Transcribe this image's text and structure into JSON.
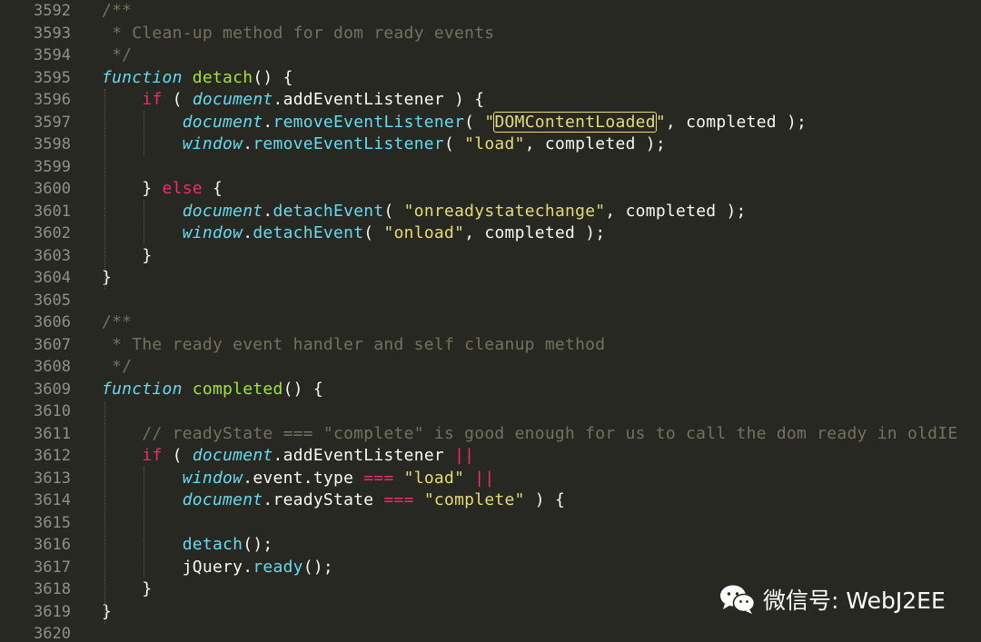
{
  "watermark": {
    "icon": "wechat-icon",
    "label": "微信号: WebJ2EE"
  },
  "colors": {
    "background": "#272822",
    "comment": "#75715e",
    "keyword": "#f92672",
    "function_name": "#a6e22e",
    "storage": "#66d9ef",
    "string": "#e6db74",
    "text": "#f8f8f2",
    "line_number": "#90908a"
  },
  "lines": [
    {
      "num": "3592",
      "tokens": [
        {
          "t": "comment",
          "v": "/**"
        }
      ]
    },
    {
      "num": "3593",
      "tokens": [
        {
          "t": "comment",
          "v": " * Clean-up method for dom ready events"
        }
      ]
    },
    {
      "num": "3594",
      "tokens": [
        {
          "t": "comment",
          "v": " */"
        }
      ]
    },
    {
      "num": "3595",
      "tokens": [
        {
          "t": "storage",
          "v": "function"
        },
        {
          "t": "plain",
          "v": " "
        },
        {
          "t": "fname",
          "v": "detach"
        },
        {
          "t": "plain",
          "v": "() {"
        }
      ]
    },
    {
      "num": "3596",
      "tokens": [
        {
          "t": "plain",
          "v": "    "
        },
        {
          "t": "keyword",
          "v": "if"
        },
        {
          "t": "plain",
          "v": " ( "
        },
        {
          "t": "builtin",
          "v": "document"
        },
        {
          "t": "plain",
          "v": ".addEventListener ) {"
        }
      ]
    },
    {
      "num": "3597",
      "tokens": [
        {
          "t": "plain",
          "v": "        "
        },
        {
          "t": "builtin",
          "v": "document"
        },
        {
          "t": "plain",
          "v": "."
        },
        {
          "t": "method",
          "v": "removeEventListener"
        },
        {
          "t": "plain",
          "v": "( "
        },
        {
          "t": "string",
          "v": "\""
        },
        {
          "t": "hl",
          "v": "DOMContentLoaded"
        },
        {
          "t": "string",
          "v": "\""
        },
        {
          "t": "plain",
          "v": ", completed );"
        }
      ]
    },
    {
      "num": "3598",
      "tokens": [
        {
          "t": "plain",
          "v": "        "
        },
        {
          "t": "builtin",
          "v": "window"
        },
        {
          "t": "plain",
          "v": "."
        },
        {
          "t": "method",
          "v": "removeEventListener"
        },
        {
          "t": "plain",
          "v": "( "
        },
        {
          "t": "string",
          "v": "\"load\""
        },
        {
          "t": "plain",
          "v": ", completed );"
        }
      ]
    },
    {
      "num": "3599",
      "tokens": []
    },
    {
      "num": "3600",
      "tokens": [
        {
          "t": "plain",
          "v": "    } "
        },
        {
          "t": "keyword",
          "v": "else"
        },
        {
          "t": "plain",
          "v": " {"
        }
      ]
    },
    {
      "num": "3601",
      "tokens": [
        {
          "t": "plain",
          "v": "        "
        },
        {
          "t": "builtin",
          "v": "document"
        },
        {
          "t": "plain",
          "v": "."
        },
        {
          "t": "method",
          "v": "detachEvent"
        },
        {
          "t": "plain",
          "v": "( "
        },
        {
          "t": "string",
          "v": "\"onreadystatechange\""
        },
        {
          "t": "plain",
          "v": ", completed );"
        }
      ]
    },
    {
      "num": "3602",
      "tokens": [
        {
          "t": "plain",
          "v": "        "
        },
        {
          "t": "builtin",
          "v": "window"
        },
        {
          "t": "plain",
          "v": "."
        },
        {
          "t": "method",
          "v": "detachEvent"
        },
        {
          "t": "plain",
          "v": "( "
        },
        {
          "t": "string",
          "v": "\"onload\""
        },
        {
          "t": "plain",
          "v": ", completed );"
        }
      ]
    },
    {
      "num": "3603",
      "tokens": [
        {
          "t": "plain",
          "v": "    }"
        }
      ]
    },
    {
      "num": "3604",
      "tokens": [
        {
          "t": "plain",
          "v": "}"
        }
      ]
    },
    {
      "num": "3605",
      "tokens": []
    },
    {
      "num": "3606",
      "tokens": [
        {
          "t": "comment",
          "v": "/**"
        }
      ]
    },
    {
      "num": "3607",
      "tokens": [
        {
          "t": "comment",
          "v": " * The ready event handler and self cleanup method"
        }
      ]
    },
    {
      "num": "3608",
      "tokens": [
        {
          "t": "comment",
          "v": " */"
        }
      ]
    },
    {
      "num": "3609",
      "tokens": [
        {
          "t": "storage",
          "v": "function"
        },
        {
          "t": "plain",
          "v": " "
        },
        {
          "t": "fname",
          "v": "completed"
        },
        {
          "t": "plain",
          "v": "() {"
        }
      ]
    },
    {
      "num": "3610",
      "tokens": []
    },
    {
      "num": "3611",
      "tokens": [
        {
          "t": "plain",
          "v": "    "
        },
        {
          "t": "comment",
          "v": "// readyState === \"complete\" is good enough for us to call the dom ready in oldIE"
        }
      ]
    },
    {
      "num": "3612",
      "tokens": [
        {
          "t": "plain",
          "v": "    "
        },
        {
          "t": "keyword",
          "v": "if"
        },
        {
          "t": "plain",
          "v": " ( "
        },
        {
          "t": "builtin",
          "v": "document"
        },
        {
          "t": "plain",
          "v": ".addEventListener "
        },
        {
          "t": "op",
          "v": "||"
        }
      ]
    },
    {
      "num": "3613",
      "tokens": [
        {
          "t": "plain",
          "v": "        "
        },
        {
          "t": "builtin",
          "v": "window"
        },
        {
          "t": "plain",
          "v": ".event.type "
        },
        {
          "t": "op",
          "v": "==="
        },
        {
          "t": "plain",
          "v": " "
        },
        {
          "t": "string",
          "v": "\"load\""
        },
        {
          "t": "plain",
          "v": " "
        },
        {
          "t": "op",
          "v": "||"
        }
      ]
    },
    {
      "num": "3614",
      "tokens": [
        {
          "t": "plain",
          "v": "        "
        },
        {
          "t": "builtin",
          "v": "document"
        },
        {
          "t": "plain",
          "v": ".readyState "
        },
        {
          "t": "op",
          "v": "==="
        },
        {
          "t": "plain",
          "v": " "
        },
        {
          "t": "string",
          "v": "\"complete\""
        },
        {
          "t": "plain",
          "v": " ) {"
        }
      ]
    },
    {
      "num": "3615",
      "tokens": []
    },
    {
      "num": "3616",
      "tokens": [
        {
          "t": "plain",
          "v": "        "
        },
        {
          "t": "method",
          "v": "detach"
        },
        {
          "t": "plain",
          "v": "();"
        }
      ]
    },
    {
      "num": "3617",
      "tokens": [
        {
          "t": "plain",
          "v": "        jQuery."
        },
        {
          "t": "method",
          "v": "ready"
        },
        {
          "t": "plain",
          "v": "();"
        }
      ]
    },
    {
      "num": "3618",
      "tokens": [
        {
          "t": "plain",
          "v": "    }"
        }
      ]
    },
    {
      "num": "3619",
      "tokens": [
        {
          "t": "plain",
          "v": "}"
        }
      ]
    },
    {
      "num": "3620",
      "tokens": []
    }
  ]
}
